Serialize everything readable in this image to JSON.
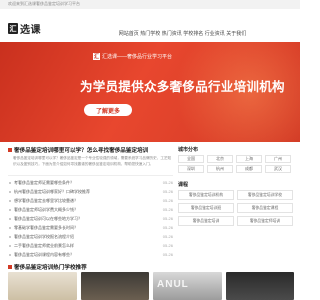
{
  "topbar": {
    "text": "欢迎来到汇选课奢侈品鉴定培训学习平台"
  },
  "header": {
    "logo_mark": "汇",
    "logo_text": "选课",
    "nav": [
      "网站首页",
      "热门学校",
      "热门资讯",
      "学校排名",
      "行业资讯",
      "关于我们"
    ]
  },
  "banner": {
    "badge_mark": "汇",
    "badge_text": "汇选课——奢侈品行业学习平台",
    "title": "为学员提供众多奢侈品行业培训机构",
    "button": "了解更多"
  },
  "main": {
    "title": "奢侈品鉴定培训哪里可以学？怎么寻找奢侈品鉴定培训",
    "desc": "奢侈品鉴定培训哪里可以学？奢侈品鉴定是一个专业性较强的领域，需要系统学习品牌历史、工艺知识以及鉴别技巧，下面为您介绍如何寻找靠谱的奢侈品鉴定培训机构，帮助您快速入门。",
    "news": [
      {
        "title": "考奢侈品鉴定师证需要哪些条件？",
        "date": "05-26"
      },
      {
        "title": "杭州奢侈品鉴定培训哪家好？口碑学校推荐",
        "date": "05-26"
      },
      {
        "title": "想学奢侈品鉴定去哪里学比较靠谱？",
        "date": "05-26"
      },
      {
        "title": "奢侈品鉴定师培训学费大概多少钱？",
        "date": "05-26"
      },
      {
        "title": "奢侈品鉴定培训可以在哪些地方学习？",
        "date": "05-26"
      },
      {
        "title": "零基础学奢侈品鉴定需要多长时间？",
        "date": "05-26"
      },
      {
        "title": "奢侈品鉴定培训学校报名流程介绍",
        "date": "05-26"
      },
      {
        "title": "二手奢侈品鉴定师就业前景怎么样",
        "date": "05-26"
      },
      {
        "title": "奢侈品鉴定培训课程内容有哪些？",
        "date": "05-26"
      }
    ],
    "section2_title": "奢侈品鉴定培训热门学校推荐"
  },
  "sidebar": {
    "city_heading": "城市分布",
    "cities": [
      "全国",
      "北京",
      "上海",
      "广州",
      "深圳",
      "杭州",
      "成都",
      "武汉"
    ],
    "cat_heading": "课程",
    "categories": [
      "奢侈品鉴定培训机构",
      "奢侈品鉴定培训学校",
      "奢侈品鉴定培训班",
      "奢侈品鉴定课程",
      "奢侈品鉴定培训",
      "奢侈品鉴定师培训"
    ]
  },
  "thumbs": [
    {
      "watermark": ""
    },
    {
      "watermark": ""
    },
    {
      "watermark": "ANUL"
    },
    {
      "watermark": ""
    }
  ],
  "colors": {
    "brand": "#d23a25",
    "banner_start": "#c9301e",
    "banner_end": "#e8472e"
  }
}
